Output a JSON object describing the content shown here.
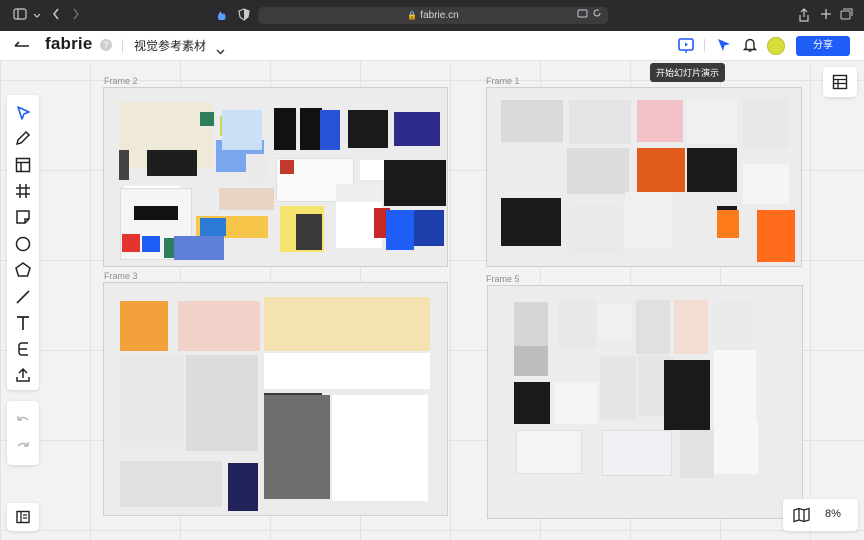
{
  "browser": {
    "url": "fabrie.cn"
  },
  "header": {
    "logo": "fabrie",
    "help": "?",
    "project_title": "视觉参考素材",
    "share_label": "分享",
    "tooltip": "开始幻灯片演示"
  },
  "frames": [
    {
      "label": "Frame 2"
    },
    {
      "label": "Frame 1"
    },
    {
      "label": "Frame 3"
    },
    {
      "label": "Frame 5"
    }
  ],
  "zoom": "8%",
  "colors": {
    "accent": "#1f5df7",
    "avatar": "#d6df3e"
  },
  "icons": [
    "sidebar-icon",
    "back-icon",
    "forward-icon",
    "shield-icon",
    "lock-icon",
    "tabs-icon",
    "reload-icon",
    "share-icon",
    "plus-icon",
    "tab-overview-icon",
    "menu-icon",
    "presentation-icon",
    "cursor-icon",
    "bell-icon",
    "select-icon",
    "pen-icon",
    "frame-icon",
    "grid-icon",
    "note-icon",
    "circle-icon",
    "pentagon-icon",
    "line-icon",
    "text-icon",
    "connector-icon",
    "upload-icon",
    "undo-icon",
    "redo-icon",
    "outline-icon",
    "table-icon",
    "map-icon"
  ]
}
